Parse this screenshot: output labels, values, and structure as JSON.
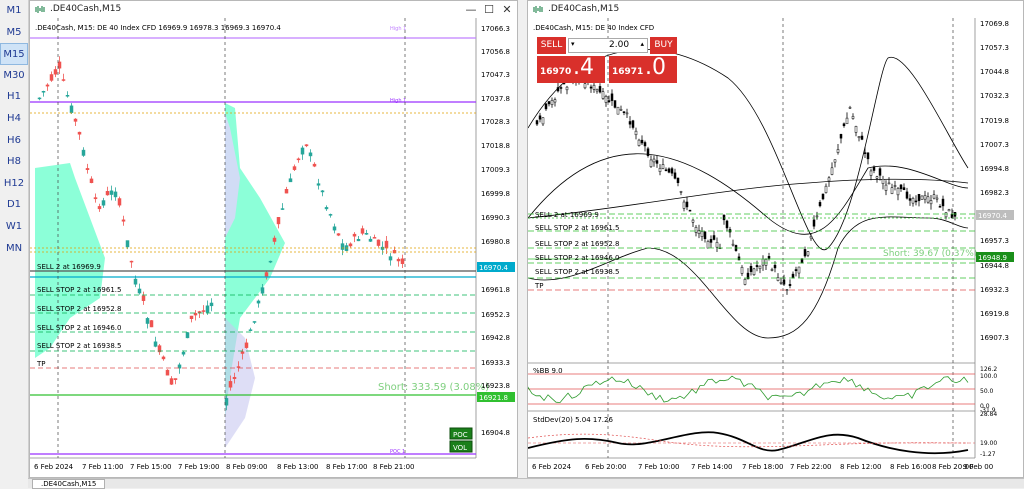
{
  "timeframes": [
    "M1",
    "M5",
    "M15",
    "M30",
    "H1",
    "H4",
    "H6",
    "H8",
    "H12",
    "D1",
    "W1",
    "MN"
  ],
  "active_timeframe": "M15",
  "left": {
    "title": ".DE40Cash,M15",
    "info": ".DE40Cash, M15:  DE 40 Index CFD   16969.9 16978.3 16969.3 16970.4",
    "price_axis": [
      "17066.3",
      "17056.8",
      "17047.3",
      "17037.8",
      "17028.3",
      "17018.8",
      "17009.3",
      "16999.8",
      "16990.3",
      "16980.8",
      "16970.4",
      "16961.8",
      "16952.3",
      "16942.8",
      "16933.3",
      "16923.8",
      "16921.8",
      "16904.8"
    ],
    "time_axis": [
      "6 Feb 2024",
      "7 Feb 11:00",
      "7 Feb 15:00",
      "7 Feb 19:00",
      "8 Feb 09:00",
      "8 Feb 13:00",
      "8 Feb 17:00",
      "8 Feb 21:00"
    ],
    "orders": [
      "SELL 2 at 16969.9",
      "SELL STOP 2 at 16961.5",
      "SELL STOP 2 at 16952.8",
      "SELL STOP 2 at 16946.0",
      "SELL STOP 2 at 16938.5",
      "TP"
    ],
    "profit_text": "Short: 333.59  (3.08%)",
    "current_price": "16970.4",
    "short_price": "16921.8",
    "poc_label": "POC",
    "vol_label": "VOL",
    "hline_labels": [
      "High 1",
      "Low 1",
      "POC 1"
    ]
  },
  "right": {
    "title": ".DE40Cash,M15",
    "info": ".DE40Cash, M15:  DE 40 Index CFD",
    "sell_label": "SELL",
    "buy_label": "BUY",
    "volume": "2.00",
    "sell_price_small": "16970",
    "sell_price_big": ".4",
    "buy_price_small": "16971",
    "buy_price_big": ".0",
    "price_axis": [
      "17069.8",
      "17057.3",
      "17044.8",
      "17032.3",
      "17019.8",
      "17007.3",
      "16994.8",
      "16982.3",
      "16970.4",
      "16957.3",
      "16948.9",
      "16944.8",
      "16932.3",
      "16919.8",
      "16907.3"
    ],
    "time_axis": [
      "6 Feb 2024",
      "6 Feb 20:00",
      "7 Feb 10:00",
      "7 Feb 14:00",
      "7 Feb 18:00",
      "7 Feb 22:00",
      "8 Feb 12:00",
      "8 Feb 16:00",
      "8 Feb 20:00",
      "9 Feb 00"
    ],
    "orders": [
      "SELL 2 at 16969.9",
      "SELL STOP 2 at 16961.5",
      "SELL STOP 2 at 16952.8",
      "SELL STOP 2 at 16946.0",
      "SELL STOP 2 at 16938.5",
      "TP"
    ],
    "profit_text": "Short: 39.67  (0.37%)",
    "current_price": "16970.4",
    "entry_price": "16948.9",
    "bb_label": "%BB 9.0",
    "bb_axis": [
      "126.2",
      "100.0",
      "50.0",
      "0.0",
      "-31.9"
    ],
    "sd_label": "StdDev(20) 5.04 17.26",
    "sd_axis": [
      "28.84",
      "19.00",
      "-1.27"
    ]
  },
  "bottom_tab": ".DE40Cash,M15",
  "colors": {
    "bull": "#26a69a",
    "bear": "#ef5350",
    "profile": "#7fffd4",
    "accent": "#d9302b"
  }
}
